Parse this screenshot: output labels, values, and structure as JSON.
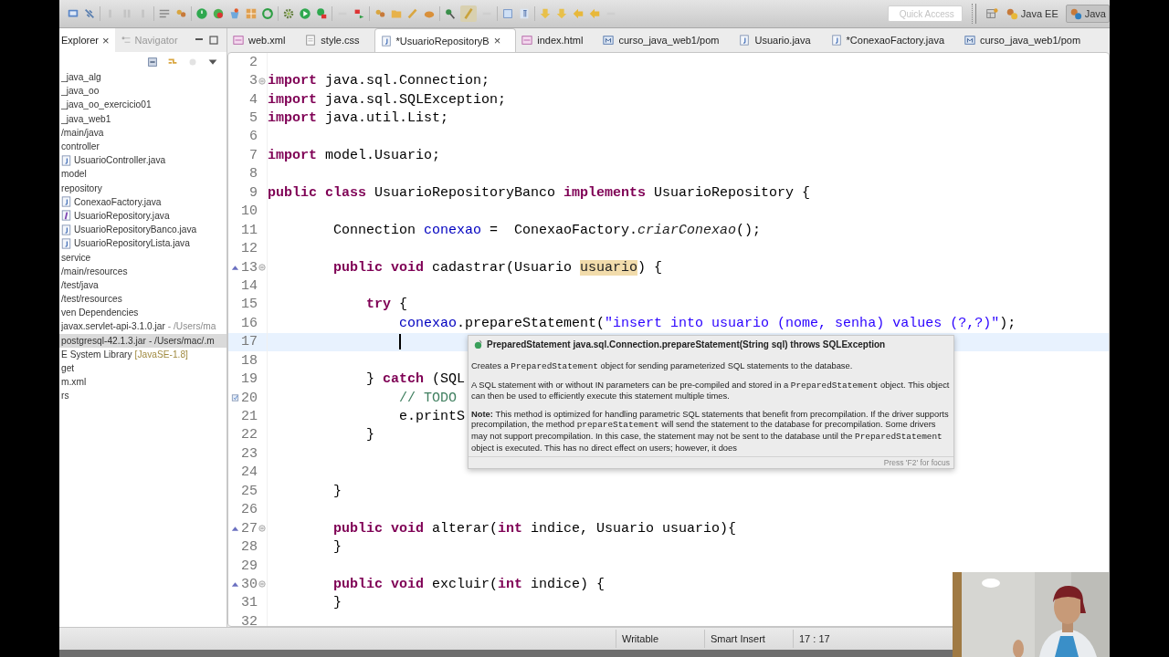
{
  "toolbar": {
    "quick_access": {
      "placeholder": "Quick Access"
    },
    "perspectives": [
      {
        "label": "Java EE",
        "selected": false
      },
      {
        "label": "Java",
        "selected": true
      }
    ]
  },
  "explorer": {
    "tabs": [
      {
        "label": "Explorer",
        "selected": true,
        "close": "×"
      },
      {
        "label": "Navigator",
        "selected": false
      }
    ],
    "tree": [
      {
        "label": "_java_alg",
        "selected": false
      },
      {
        "label": "_java_oo",
        "selected": false
      },
      {
        "label": "_java_oo_exercicio01",
        "selected": false
      },
      {
        "label": "_java_web1",
        "selected": false
      },
      {
        "label": "/main/java",
        "selected": false
      },
      {
        "label": "controller",
        "selected": false,
        "children": [
          {
            "label": "UsuarioController.java",
            "kind": "class",
            "selected": false
          }
        ]
      },
      {
        "label": "model",
        "selected": false
      },
      {
        "label": "repository",
        "selected": false,
        "children": [
          {
            "label": "ConexaoFactory.java",
            "kind": "class",
            "selected": false
          },
          {
            "label": "UsuarioRepository.java",
            "kind": "interface",
            "selected": false
          },
          {
            "label": "UsuarioRepositoryBanco.java",
            "kind": "class",
            "selected": false
          },
          {
            "label": "UsuarioRepositoryLista.java",
            "kind": "class",
            "selected": false
          }
        ]
      },
      {
        "label": "service",
        "selected": false
      },
      {
        "label": "/main/resources",
        "selected": false
      },
      {
        "label": "/test/java",
        "selected": false
      },
      {
        "label": "/test/resources",
        "selected": false
      },
      {
        "label": "ven Dependencies",
        "selected": false
      },
      {
        "label": "javax.servlet-api-3.1.0.jar",
        "detail": "- /Users/ma",
        "selected": false
      },
      {
        "label": "postgresql-42.1.3.jar",
        "detail": "- /Users/mac/.m",
        "selected": true
      },
      {
        "label": "E System Library",
        "tag": "[JavaSE-1.8]",
        "selected": false
      },
      {
        "label": "get",
        "selected": false
      },
      {
        "label": "m.xml",
        "selected": false
      },
      {
        "label": "rs",
        "selected": false
      }
    ]
  },
  "editor": {
    "tabs": [
      {
        "label": "web.xml",
        "kind": "xml",
        "selected": false
      },
      {
        "label": "style.css",
        "kind": "css",
        "selected": false
      },
      {
        "label": "*UsuarioRepositoryB",
        "kind": "java",
        "selected": true,
        "close": "×"
      },
      {
        "label": "index.html",
        "kind": "xml",
        "selected": false
      },
      {
        "label": "curso_java_web1/pom",
        "kind": "maven",
        "selected": false
      },
      {
        "label": "Usuario.java",
        "kind": "java",
        "selected": false
      },
      {
        "label": "*ConexaoFactory.java",
        "kind": "java",
        "selected": false
      },
      {
        "label": "curso_java_web1/pom",
        "kind": "maven",
        "selected": false
      }
    ],
    "lines": [
      {
        "number": "2",
        "kind": "plain",
        "current": false
      },
      {
        "number": "3",
        "kind": "fold",
        "current": false,
        "tokens": [
          {
            "kind": "kw",
            "text": "import"
          },
          {
            "kind": "plain",
            "text": " java.sql.Connection;"
          }
        ]
      },
      {
        "number": "4",
        "kind": "plain",
        "current": false,
        "tokens": [
          {
            "kind": "kw",
            "text": "import"
          },
          {
            "kind": "plain",
            "text": " java.sql.SQLException;"
          }
        ]
      },
      {
        "number": "5",
        "kind": "plain",
        "current": false,
        "tokens": [
          {
            "kind": "kw",
            "text": "import"
          },
          {
            "kind": "plain",
            "text": " java.util.List;"
          }
        ]
      },
      {
        "number": "6",
        "kind": "plain",
        "current": false
      },
      {
        "number": "7",
        "kind": "plain",
        "current": false,
        "tokens": [
          {
            "kind": "kw",
            "text": "import"
          },
          {
            "kind": "plain",
            "text": " model.Usuario;"
          }
        ]
      },
      {
        "number": "8",
        "kind": "plain",
        "current": false
      },
      {
        "number": "9",
        "kind": "plain",
        "current": false,
        "tokens": [
          {
            "kind": "kw",
            "text": "public class"
          },
          {
            "kind": "plain",
            "text": " UsuarioRepositoryBanco "
          },
          {
            "kind": "kw",
            "text": "implements"
          },
          {
            "kind": "plain",
            "text": " UsuarioRepository {"
          }
        ]
      },
      {
        "number": "10",
        "kind": "plain",
        "current": false
      },
      {
        "number": "11",
        "kind": "plain",
        "current": false,
        "tokens": [
          {
            "kind": "plain",
            "text": "        Connection "
          },
          {
            "kind": "field",
            "text": "conexao"
          },
          {
            "kind": "plain",
            "text": " =  ConexaoFactory."
          },
          {
            "kind": "static",
            "text": "criarConexao"
          },
          {
            "kind": "plain",
            "text": "();"
          }
        ]
      },
      {
        "number": "12",
        "kind": "plain",
        "current": false
      },
      {
        "number": "13",
        "kind": "override",
        "current": false,
        "tokens": [
          {
            "kind": "kw",
            "text": "        public void"
          },
          {
            "kind": "plain",
            "text": " cadastrar(Usuario "
          },
          {
            "kind": "occurrence",
            "text": "usuario"
          },
          {
            "kind": "plain",
            "text": ") {"
          }
        ]
      },
      {
        "number": "14",
        "kind": "plain",
        "current": false
      },
      {
        "number": "15",
        "kind": "plain",
        "current": false,
        "tokens": [
          {
            "kind": "kw",
            "text": "            try"
          },
          {
            "kind": "plain",
            "text": " {"
          }
        ]
      },
      {
        "number": "16",
        "kind": "plain",
        "current": false,
        "tokens": [
          {
            "kind": "field",
            "text": "                conexao"
          },
          {
            "kind": "plain",
            "text": ".prepareStatement("
          },
          {
            "kind": "string",
            "text": "\"insert into usuario (nome, senha) values (?,?)\""
          },
          {
            "kind": "plain",
            "text": ");"
          }
        ]
      },
      {
        "number": "17",
        "kind": "plain",
        "current": true
      },
      {
        "number": "18",
        "kind": "plain",
        "current": false
      },
      {
        "number": "19",
        "kind": "plain",
        "current": false,
        "tokens": [
          {
            "kind": "plain",
            "text": "            } "
          },
          {
            "kind": "kw",
            "text": "catch"
          },
          {
            "kind": "plain",
            "text": " (SQL"
          }
        ]
      },
      {
        "number": "20",
        "kind": "task",
        "current": false,
        "tokens": [
          {
            "kind": "comment",
            "text": "                // TODO"
          }
        ]
      },
      {
        "number": "21",
        "kind": "plain",
        "current": false,
        "tokens": [
          {
            "kind": "plain",
            "text": "                e.printS"
          }
        ]
      },
      {
        "number": "22",
        "kind": "plain",
        "current": false,
        "tokens": [
          {
            "kind": "plain",
            "text": "            }"
          }
        ]
      },
      {
        "number": "23",
        "kind": "plain",
        "current": false
      },
      {
        "number": "24",
        "kind": "plain",
        "current": false
      },
      {
        "number": "25",
        "kind": "plain",
        "current": false,
        "tokens": [
          {
            "kind": "plain",
            "text": "        }"
          }
        ]
      },
      {
        "number": "26",
        "kind": "plain",
        "current": false
      },
      {
        "number": "27",
        "kind": "override",
        "current": false,
        "tokens": [
          {
            "kind": "kw",
            "text": "        public void"
          },
          {
            "kind": "plain",
            "text": " alterar("
          },
          {
            "kind": "kw",
            "text": "int"
          },
          {
            "kind": "plain",
            "text": " indice, Usuario usuario){"
          }
        ]
      },
      {
        "number": "28",
        "kind": "plain",
        "current": false,
        "tokens": [
          {
            "kind": "plain",
            "text": "        }"
          }
        ]
      },
      {
        "number": "29",
        "kind": "plain",
        "current": false
      },
      {
        "number": "30",
        "kind": "override",
        "current": false,
        "tokens": [
          {
            "kind": "kw",
            "text": "        public void"
          },
          {
            "kind": "plain",
            "text": " excluir("
          },
          {
            "kind": "kw",
            "text": "int"
          },
          {
            "kind": "plain",
            "text": " indice) {"
          }
        ]
      },
      {
        "number": "31",
        "kind": "plain",
        "current": false,
        "tokens": [
          {
            "kind": "plain",
            "text": "        }"
          }
        ]
      },
      {
        "number": "32",
        "kind": "plain",
        "current": false
      }
    ],
    "hover": {
      "signature": "PreparedStatement java.sql.Connection.prepareStatement(String sql) throws SQLException",
      "paragraphs": [
        [
          {
            "kind": "text",
            "text": "Creates a "
          },
          {
            "kind": "code",
            "text": "PreparedStatement"
          },
          {
            "kind": "text",
            "text": " object for sending parameterized SQL statements to the database."
          }
        ],
        [
          {
            "kind": "text",
            "text": "A SQL statement with or without IN parameters can be pre-compiled and stored in a "
          },
          {
            "kind": "code",
            "text": "PreparedStatement"
          },
          {
            "kind": "text",
            "text": " object. This object can then be used to efficiently execute this statement multiple times."
          }
        ],
        [
          {
            "kind": "bold",
            "text": "Note:"
          },
          {
            "kind": "text",
            "text": " This method is optimized for handling parametric SQL statements that benefit from precompilation. If the driver supports precompilation, the method "
          },
          {
            "kind": "code",
            "text": "prepareStatement"
          },
          {
            "kind": "text",
            "text": " will send the statement to the database for precompilation. Some drivers may not support precompilation. In this case, the statement may not be sent to the database until the "
          },
          {
            "kind": "code",
            "text": "PreparedStatement"
          },
          {
            "kind": "text",
            "text": " object is executed. This has no direct effect on users; however, it does"
          }
        ]
      ],
      "footer": "Press 'F2' for focus"
    }
  },
  "status_bar": {
    "fields": [
      "Writable",
      "Smart Insert",
      "17 : 17"
    ]
  }
}
